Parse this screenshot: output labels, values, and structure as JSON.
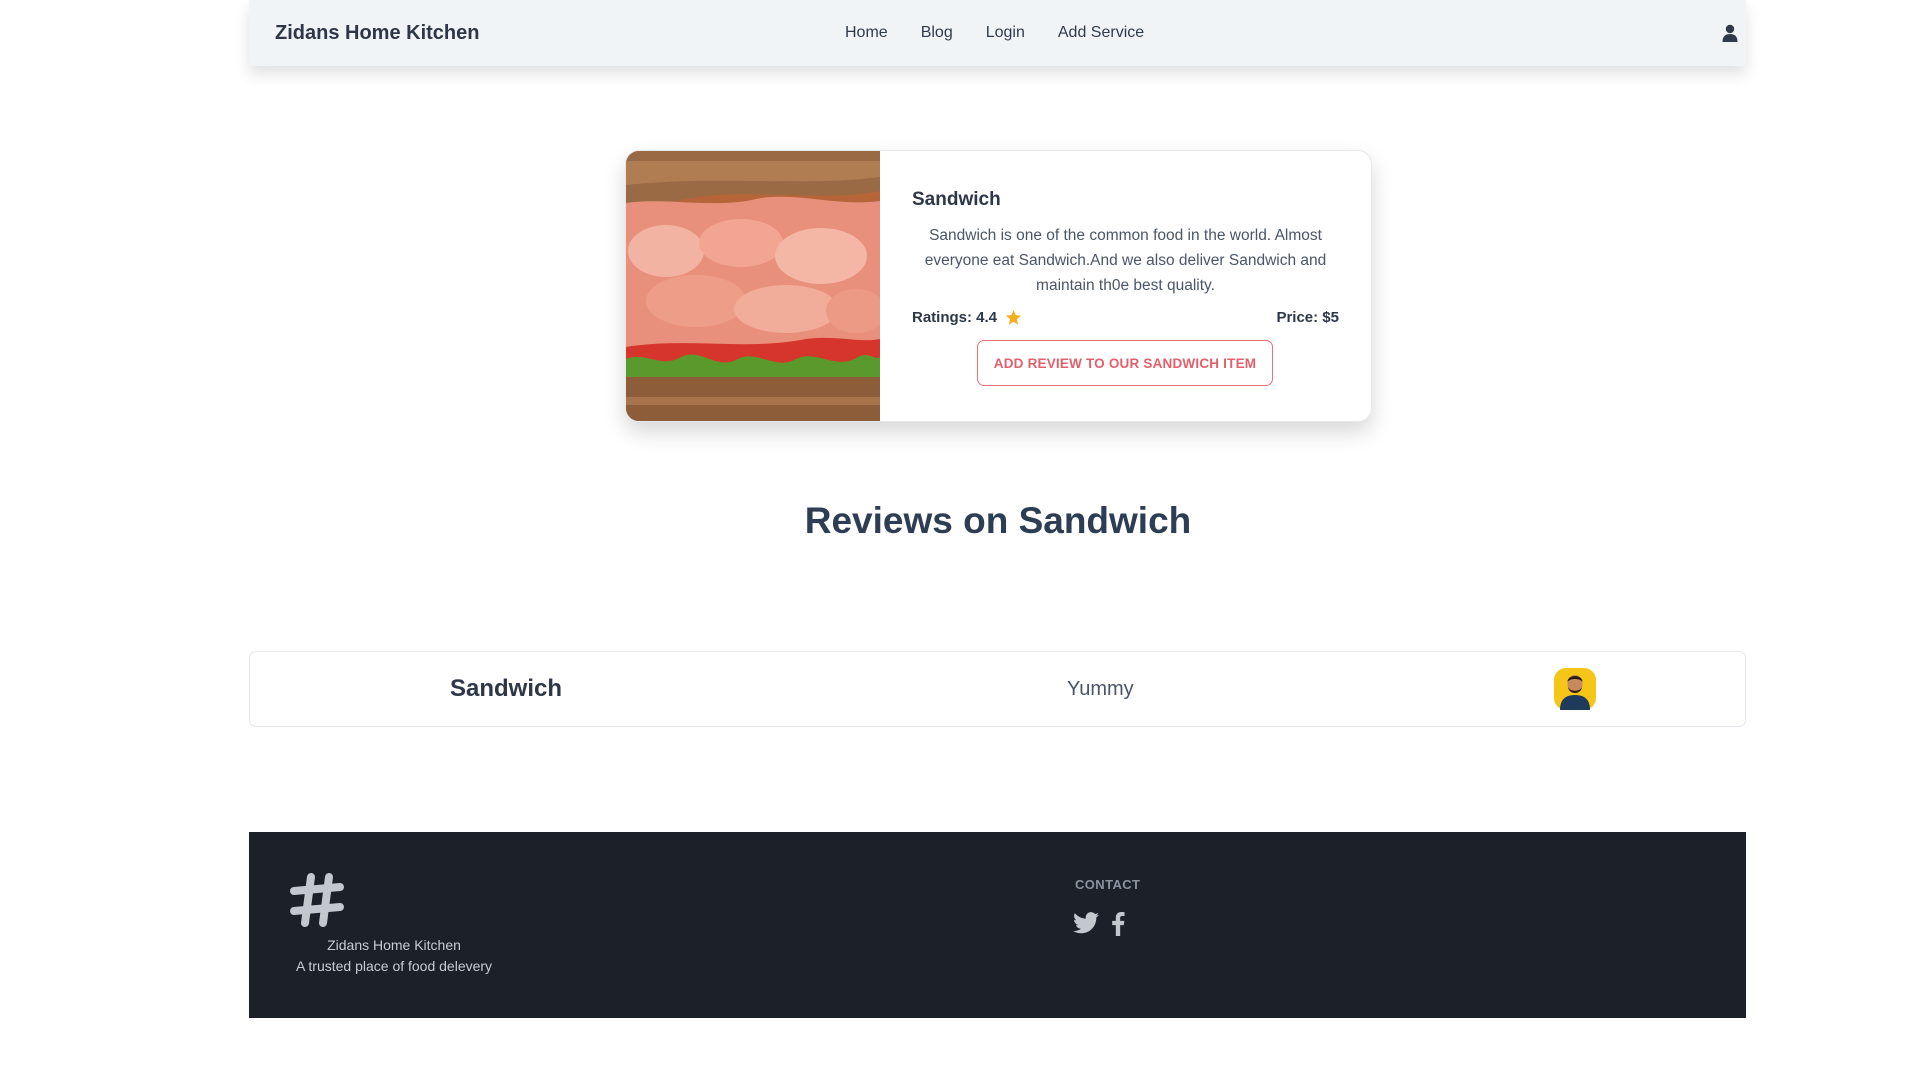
{
  "navbar": {
    "brand": "Zidans Home Kitchen",
    "links": [
      "Home",
      "Blog",
      "Login",
      "Add Service"
    ],
    "user_icon": "user-icon"
  },
  "service": {
    "title": "Sandwich",
    "description": "Sandwich is one of the common food in the world. Almost everyone eat Sandwich.And we also deliver Sandwich and maintain th0e best quality.",
    "ratings_label": "Ratings: 4.4",
    "price_label": "Price: $5",
    "review_button": "ADD REVIEW TO OUR SANDWICH ITEM",
    "star_icon": "star-icon",
    "star_color": "#f2b01e"
  },
  "reviews": {
    "heading": "Reviews on Sandwich",
    "items": [
      {
        "service": "Sandwich",
        "text": "Yummy",
        "avatar": "user-avatar"
      }
    ]
  },
  "footer": {
    "logo_icon": "hashtag-icon",
    "name": "Zidans Home Kitchen",
    "tagline": "A trusted place of food delevery",
    "contact_label": "CONTACT",
    "social_icons": [
      "twitter-icon",
      "facebook-icon"
    ]
  },
  "colors": {
    "accent": "#ec6f7a",
    "navbar_bg": "#f1f4f7",
    "footer_bg": "#1b2029"
  }
}
